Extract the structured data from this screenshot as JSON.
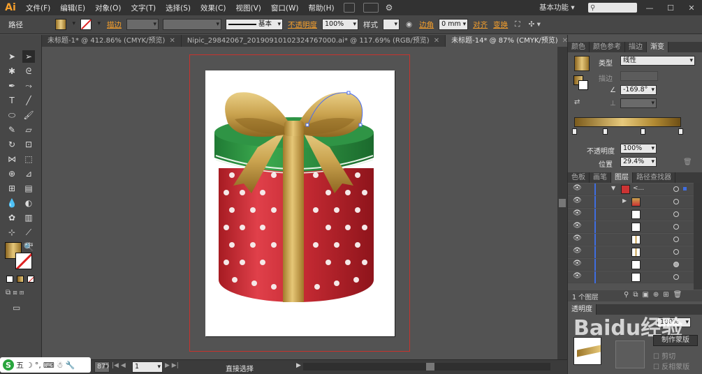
{
  "app": {
    "logo": "Ai"
  },
  "menu": [
    "文件(F)",
    "编辑(E)",
    "对象(O)",
    "文字(T)",
    "选择(S)",
    "效果(C)",
    "视图(V)",
    "窗口(W)",
    "帮助(H)"
  ],
  "workspace": "基本功能",
  "window_controls": [
    "—",
    "☐",
    "✕"
  ],
  "control_bar": {
    "path_label": "路径",
    "stroke_label": "描边",
    "stroke_style": "基本",
    "opacity_label": "不透明度",
    "opacity_value": "100%",
    "style_label": "样式",
    "corner_label": "边角",
    "corner_value": "0 mm",
    "align_label": "对齐",
    "transform_label": "变换"
  },
  "tabs": [
    {
      "label": "未标题-1* @ 412.86% (CMYK/预览)",
      "close": "✕"
    },
    {
      "label": "Nipic_29842067_20190910102324767000.ai* @ 117.69% (RGB/预览)",
      "close": "✕"
    },
    {
      "label": "未标题-14* @ 87% (CMYK/预览)",
      "close": "✕"
    }
  ],
  "status": {
    "zoom": "87%",
    "page": "1",
    "tool": "直接选择"
  },
  "ime": {
    "label": "五"
  },
  "panels": {
    "top_tabs": [
      "颜色",
      "颜色参考",
      "描边",
      "渐变"
    ],
    "gradient": {
      "type_label": "类型",
      "type_value": "线性",
      "stroke_label": "描边",
      "angle_value": "-169.8°",
      "opacity_label": "不透明度",
      "opacity_value": "100%",
      "position_label": "位置",
      "position_value": "29.4%"
    },
    "mid_tabs": [
      "色板",
      "画笔",
      "图层",
      "路径查找器"
    ],
    "layers": {
      "count_label": "1 个图层",
      "top_name": "<..."
    },
    "transparency_tab": "透明度",
    "transparency_value": "100%",
    "mask_button": "制作蒙版",
    "clip_label": "剪切",
    "invert_label": "反相蒙版",
    "watermark": "Baidu经验"
  }
}
